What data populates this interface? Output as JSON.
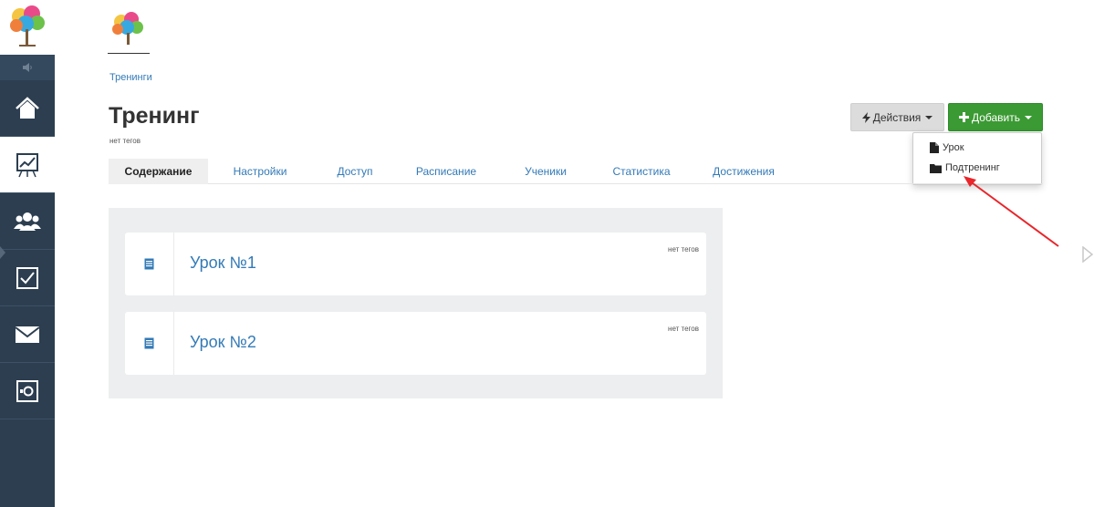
{
  "sidebar": {
    "items": [
      {
        "icon": "home-icon"
      },
      {
        "icon": "chart-board-icon",
        "active": true
      },
      {
        "icon": "users-icon"
      },
      {
        "icon": "checkbox-icon"
      },
      {
        "icon": "mail-icon"
      },
      {
        "icon": "safe-icon"
      }
    ]
  },
  "breadcrumb": "Тренинги",
  "page": {
    "title": "Тренинг",
    "tags": "нет тегов"
  },
  "tabs": [
    {
      "label": "Содержание",
      "active": true
    },
    {
      "label": "Настройки"
    },
    {
      "label": "Доступ"
    },
    {
      "label": "Расписание"
    },
    {
      "label": "Ученики"
    },
    {
      "label": "Статистика"
    },
    {
      "label": "Достижения"
    }
  ],
  "buttons": {
    "actions_label": "Действия",
    "add_label": "Добавить"
  },
  "dropdown": {
    "items": [
      {
        "label": "Урок",
        "icon": "file-icon"
      },
      {
        "label": "Подтренинг",
        "icon": "folder-icon"
      }
    ]
  },
  "lessons": [
    {
      "title": "Урок №1",
      "tags": "нет тегов",
      "icon": "lesson-doc-icon"
    },
    {
      "title": "Урок №2",
      "tags": "нет тегов",
      "icon": "lesson-doc-icon"
    }
  ],
  "colors": {
    "sidebar": "#2c3e50",
    "link": "#337ab7",
    "add_button": "#3b9a33",
    "annotation_arrow": "#e8262b"
  }
}
